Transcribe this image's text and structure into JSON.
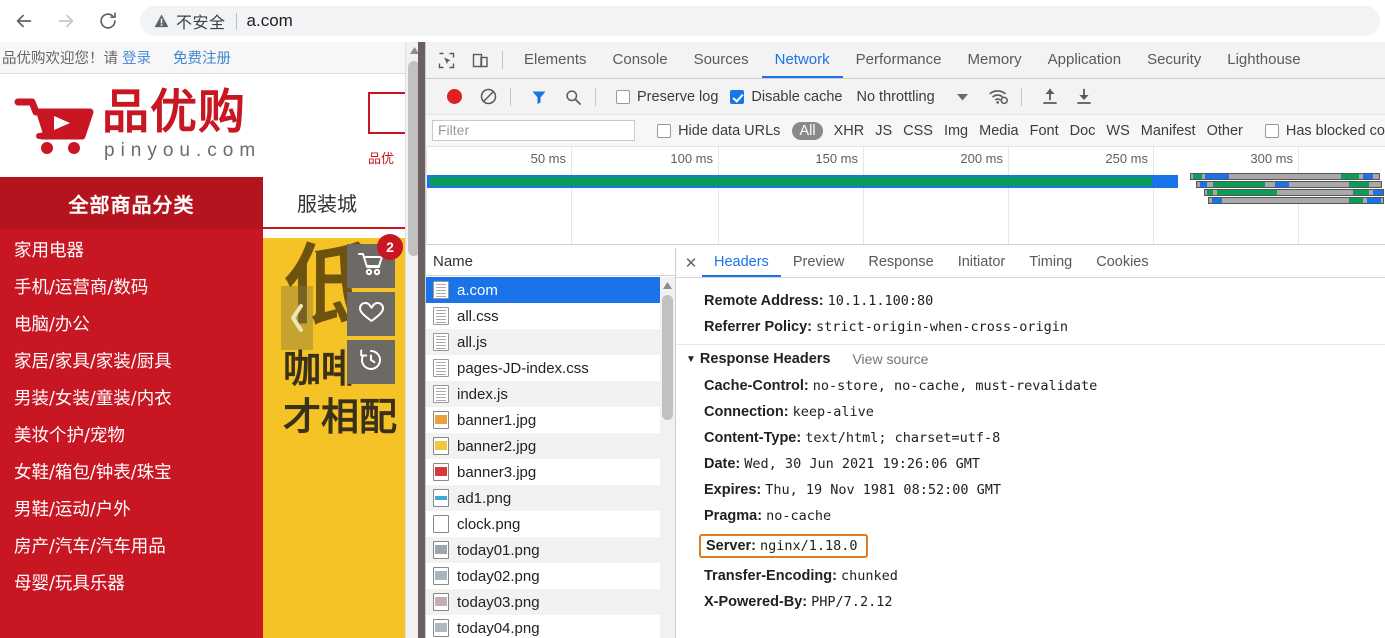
{
  "browser": {
    "back_icon": "back-arrow-icon",
    "forward_icon": "forward-arrow-icon",
    "reload_icon": "reload-icon",
    "security_warning_icon": "warning-triangle-icon",
    "security_label": "不安全",
    "url": "a.com"
  },
  "page": {
    "topbar": {
      "welcome": "品优购欢迎您！请",
      "login": "登录",
      "register": "免费注册"
    },
    "logo": {
      "cn": "品优购",
      "en": "pinyou.com",
      "cart_icon": "shopping-cart-logo-icon"
    },
    "search": {
      "value": "",
      "hotword": "品优"
    },
    "nav": {
      "all_categories": "全部商品分类",
      "items": [
        "服装城"
      ]
    },
    "categories": [
      "家用电器",
      "手机/运营商/数码",
      "电脑/办公",
      "家居/家具/家装/厨具",
      "男装/女装/童装/内衣",
      "美妆个护/宠物",
      "女鞋/箱包/钟表/珠宝",
      "男鞋/运动/户外",
      "房产/汽车/汽车用品",
      "母婴/玩具乐器"
    ],
    "banner": {
      "headline": "低",
      "subline_1": "咖啡",
      "subline_2": "才相配",
      "prev_icon": "chevron-left-icon",
      "bg_color": "#f6c326"
    },
    "float_sidebar": [
      {
        "icon": "shopping-cart-icon",
        "badge": "2"
      },
      {
        "icon": "heart-icon",
        "badge": ""
      },
      {
        "icon": "history-clock-icon",
        "badge": ""
      }
    ]
  },
  "devtools": {
    "inspect_icon": "inspect-element-icon",
    "device_icon": "device-toolbar-icon",
    "tabs": [
      "Elements",
      "Console",
      "Sources",
      "Network",
      "Performance",
      "Memory",
      "Application",
      "Security",
      "Lighthouse"
    ],
    "active_tab": "Network",
    "toolbar": {
      "record_icon": "record-button-icon",
      "clear_icon": "clear-icon",
      "filter_icon": "filter-funnel-icon",
      "search_icon": "search-icon",
      "preserve_log_label": "Preserve log",
      "preserve_log_checked": false,
      "disable_cache_label": "Disable cache",
      "disable_cache_checked": true,
      "throttling_label": "No throttling",
      "throttle_dropdown_icon": "chevron-down-icon",
      "network_conditions_icon": "wifi-settings-icon",
      "import_har_icon": "import-har-icon",
      "export_har_icon": "export-har-icon"
    },
    "filterbar": {
      "filter_placeholder": "Filter",
      "filter_value": "",
      "hide_data_urls_label": "Hide data URLs",
      "hide_data_urls_checked": false,
      "types": [
        "All",
        "XHR",
        "JS",
        "CSS",
        "Img",
        "Media",
        "Font",
        "Doc",
        "WS",
        "Manifest",
        "Other"
      ],
      "selected_type": "All",
      "has_blocked_cookies_label": "Has blocked co",
      "has_blocked_cookies_checked": false
    },
    "overview": {
      "ticks": [
        "50 ms",
        "100 ms",
        "150 ms",
        "200 ms",
        "250 ms",
        "300 ms"
      ]
    },
    "requests": {
      "column_header": "Name",
      "rows": [
        {
          "name": "a.com",
          "type": "doc",
          "selected": true
        },
        {
          "name": "all.css",
          "type": "doc",
          "selected": false
        },
        {
          "name": "all.js",
          "type": "doc",
          "selected": false
        },
        {
          "name": "pages-JD-index.css",
          "type": "doc",
          "selected": false
        },
        {
          "name": "index.js",
          "type": "doc",
          "selected": false
        },
        {
          "name": "banner1.jpg",
          "type": "img",
          "color": "#e8a33d",
          "selected": false
        },
        {
          "name": "banner2.jpg",
          "type": "img",
          "color": "#f0c83c",
          "selected": false
        },
        {
          "name": "banner3.jpg",
          "type": "img",
          "color": "#d8393c",
          "selected": false
        },
        {
          "name": "ad1.png",
          "type": "img",
          "color": "#3fa9d6",
          "selected": false
        },
        {
          "name": "clock.png",
          "type": "img",
          "color": "#ffffff",
          "selected": false
        },
        {
          "name": "today01.png",
          "type": "img",
          "color": "#9aa7b0",
          "selected": false
        },
        {
          "name": "today02.png",
          "type": "img",
          "color": "#a9b4bb",
          "selected": false
        },
        {
          "name": "today03.png",
          "type": "img",
          "color": "#c4aeb2",
          "selected": false
        },
        {
          "name": "today04.png",
          "type": "img",
          "color": "#b0b8bd",
          "selected": false
        }
      ]
    },
    "detail": {
      "close_icon": "close-icon",
      "tabs": [
        "Headers",
        "Preview",
        "Response",
        "Initiator",
        "Timing",
        "Cookies"
      ],
      "active_tab": "Headers",
      "general": [
        {
          "key": "Remote Address:",
          "value": "10.1.1.100:80"
        },
        {
          "key": "Referrer Policy:",
          "value": "strict-origin-when-cross-origin"
        }
      ],
      "response_headers_title": "Response Headers",
      "view_source_label": "View source",
      "response_headers": [
        {
          "key": "Cache-Control:",
          "value": "no-store, no-cache, must-revalidate",
          "highlight": false
        },
        {
          "key": "Connection:",
          "value": "keep-alive",
          "highlight": false
        },
        {
          "key": "Content-Type:",
          "value": "text/html; charset=utf-8",
          "highlight": false
        },
        {
          "key": "Date:",
          "value": "Wed, 30 Jun 2021 19:26:06 GMT",
          "highlight": false
        },
        {
          "key": "Expires:",
          "value": "Thu, 19 Nov 1981 08:52:00 GMT",
          "highlight": false
        },
        {
          "key": "Pragma:",
          "value": "no-cache",
          "highlight": false
        },
        {
          "key": "Server:",
          "value": "nginx/1.18.0",
          "highlight": true
        },
        {
          "key": "Transfer-Encoding:",
          "value": "chunked",
          "highlight": false
        },
        {
          "key": "X-Powered-By:",
          "value": "PHP/7.2.12",
          "highlight": false
        }
      ],
      "highlight_color": "#e07b1f"
    }
  }
}
